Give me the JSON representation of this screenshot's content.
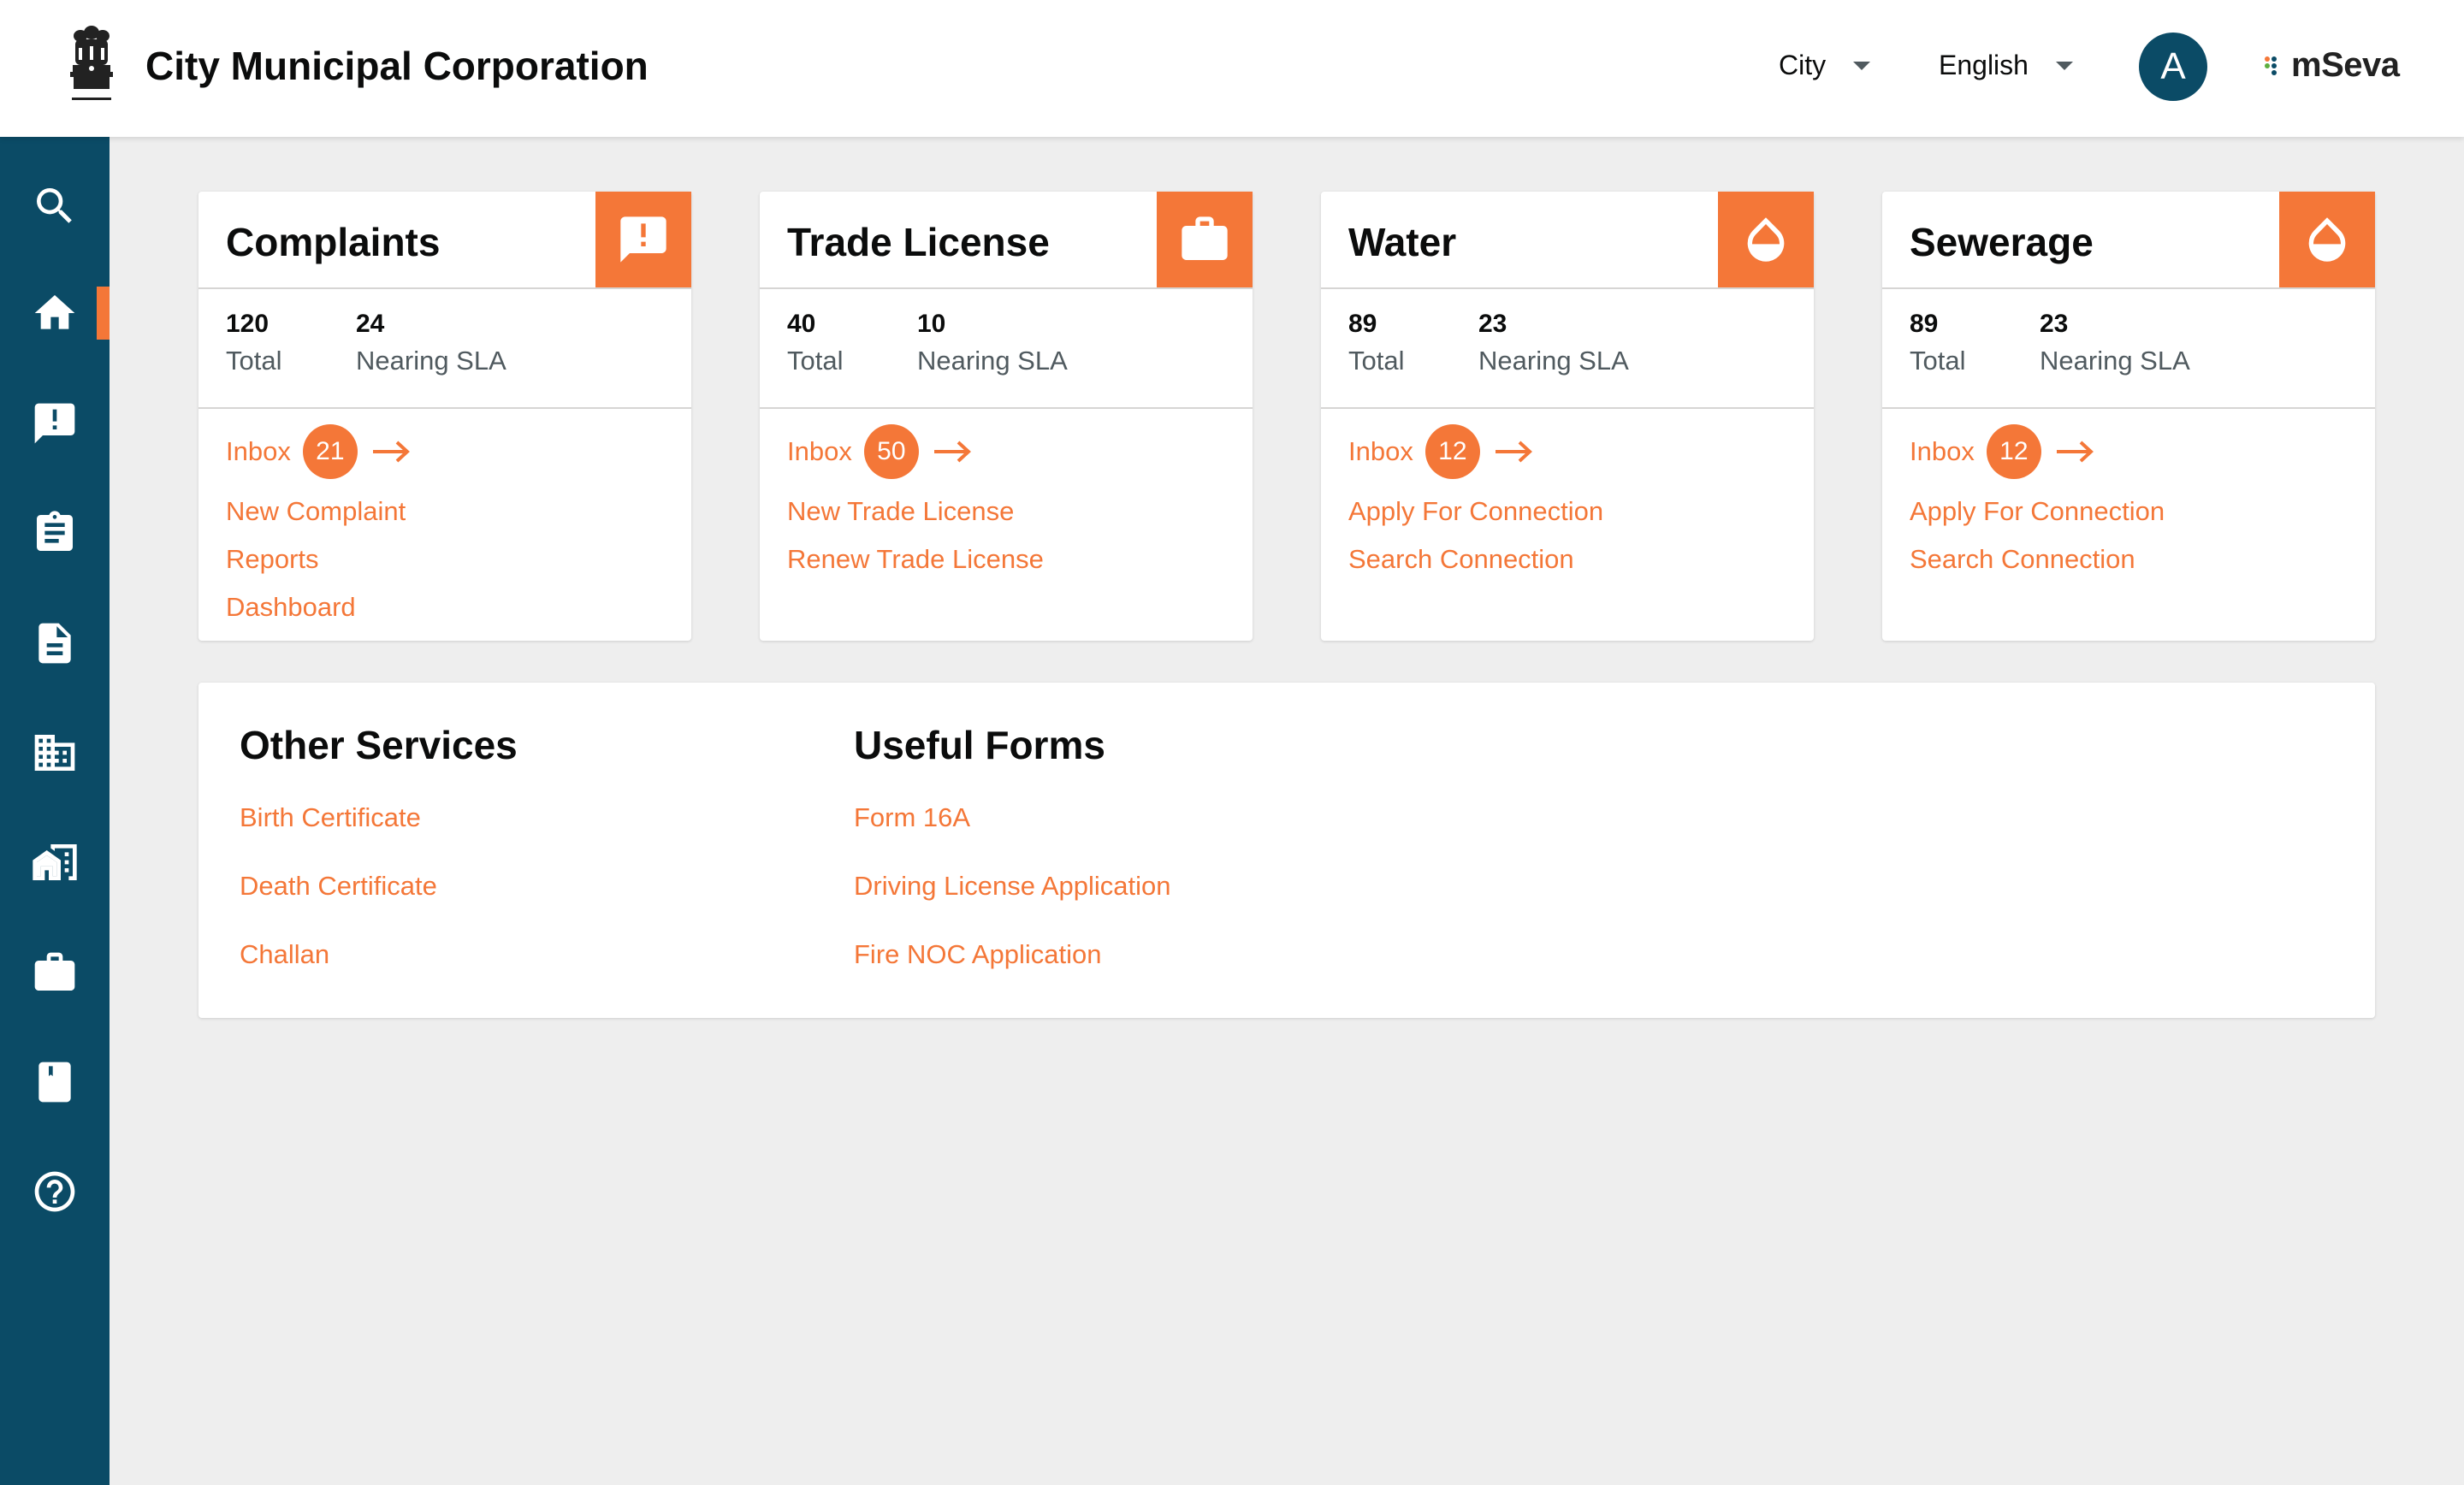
{
  "header": {
    "title": "City Municipal Corporation",
    "city_label": "City",
    "language_label": "English",
    "avatar_initial": "A",
    "brand_text": "mSeva"
  },
  "colors": {
    "primary": "#F47738",
    "sidebar": "#0B4B66",
    "background": "#EEEEEE",
    "text": "#0B0C0C",
    "secondary_text": "#505A5F"
  },
  "sidebar": {
    "items": [
      {
        "icon": "search-icon"
      },
      {
        "icon": "home-icon",
        "active": true
      },
      {
        "icon": "complaint-icon"
      },
      {
        "icon": "clipboard-icon"
      },
      {
        "icon": "document-icon"
      },
      {
        "icon": "building-icon"
      },
      {
        "icon": "property-icon"
      },
      {
        "icon": "briefcase-icon"
      },
      {
        "icon": "bookmark-icon"
      },
      {
        "icon": "help-icon"
      }
    ]
  },
  "cards": [
    {
      "title": "Complaints",
      "icon": "complaint-icon",
      "total": "120",
      "total_label": "Total",
      "sla": "24",
      "sla_label": "Nearing SLA",
      "inbox_label": "Inbox",
      "inbox_count": "21",
      "links": [
        "New Complaint",
        "Reports",
        "Dashboard"
      ]
    },
    {
      "title": "Trade License",
      "icon": "briefcase-icon",
      "total": "40",
      "total_label": "Total",
      "sla": "10",
      "sla_label": "Nearing SLA",
      "inbox_label": "Inbox",
      "inbox_count": "50",
      "links": [
        "New Trade License",
        "Renew Trade License"
      ]
    },
    {
      "title": "Water",
      "icon": "water-drop-icon",
      "total": "89",
      "total_label": "Total",
      "sla": "23",
      "sla_label": "Nearing SLA",
      "inbox_label": "Inbox",
      "inbox_count": "12",
      "links": [
        "Apply For Connection",
        "Search Connection"
      ]
    },
    {
      "title": "Sewerage",
      "icon": "water-drop-icon",
      "total": "89",
      "total_label": "Total",
      "sla": "23",
      "sla_label": "Nearing SLA",
      "inbox_label": "Inbox",
      "inbox_count": "12",
      "links": [
        "Apply For Connection",
        "Search Connection"
      ]
    }
  ],
  "other_services": {
    "title": "Other Services",
    "links": [
      "Birth Certificate",
      "Death Certificate",
      "Challan"
    ]
  },
  "useful_forms": {
    "title": "Useful Forms",
    "links": [
      "Form 16A",
      "Driving License Application",
      "Fire NOC Application"
    ]
  }
}
